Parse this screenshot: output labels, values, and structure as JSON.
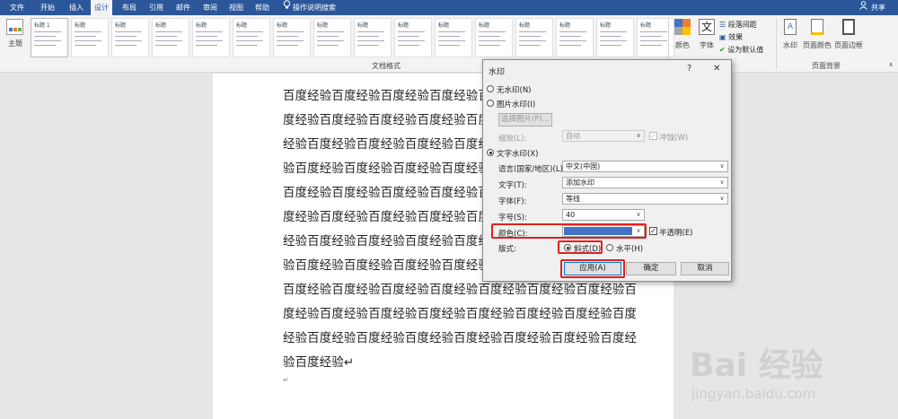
{
  "tabs": [
    "文件",
    "开始",
    "插入",
    "设计",
    "布局",
    "引用",
    "邮件",
    "审阅",
    "视图",
    "帮助"
  ],
  "search_hint": "操作说明搜索",
  "share_label": "共享",
  "ribbon": {
    "theme_label": "主题",
    "style_thumb_title": "标题",
    "style_thumb_first_title": "标题 1",
    "doc_format_label": "文档格式",
    "colors_label": "颜色",
    "fonts_label": "字体",
    "para_spacing_label": "段落间距",
    "effects_label": "效果",
    "set_default_label": "设为默认值",
    "watermark_label": "水印",
    "page_color_label": "页面颜色",
    "page_border_label": "页面边框",
    "page_bg_label": "页面背景"
  },
  "document": {
    "lines": [
      "百度经验百度经验百度经验百度经验百度经验百度",
      "度经验百度经验百度经验百度经验百度经验百度经",
      "经验百度经验百度经验百度经验百度经验百度经验",
      "验百度经验百度经验百度经验百度经验百度经验百",
      "百度经验百度经验百度经验百度经验百度经验百度",
      "度经验百度经验百度经验百度经验百度经验百度经",
      "经验百度经验百度经验百度经验百度经验百度经验",
      "验百度经验百度经验百度经验百度经验百度经验百",
      "百度经验百度经验百度经验百度经验百度经验百度经验百度经验百",
      "度经验百度经验百度经验百度经验百度经验百度经验百度经验百度",
      "经验百度经验百度经验百度经验百度经验百度经验百度经验百度经",
      "验百度经验↵",
      "↵"
    ]
  },
  "dialog": {
    "title": "水印",
    "help": "?",
    "close": "✕",
    "no_watermark": "无水印(N)",
    "picture_watermark": "图片水印(I)",
    "select_picture": "选择图片(P)...",
    "scale_label": "缩放(L):",
    "scale_value": "自动",
    "washout_label": "冲蚀(W)",
    "text_watermark": "文字水印(X)",
    "language_label": "语言(国家/地区)(L):",
    "language_value": "中文(中国)",
    "text_label": "文字(T):",
    "text_value": "添加水印",
    "font_label": "字体(F):",
    "font_value": "等线",
    "size_label": "字号(S):",
    "size_value": "40",
    "color_label": "颜色(C):",
    "color_value": "#4472c4",
    "semitransparent_label": "半透明(E)",
    "layout_label": "版式:",
    "diagonal_label": "斜式(D)",
    "horizontal_label": "水平(H)",
    "apply_button": "应用(A)",
    "ok_button": "确定",
    "cancel_button": "取消"
  },
  "site_watermark": {
    "logo": "Bai 经验",
    "url": "jingyan.baidu.com"
  },
  "colors": {
    "ribbon_blue": "#2b579a",
    "highlight_red": "#e02020",
    "swatch_blue": "#4472c4"
  }
}
